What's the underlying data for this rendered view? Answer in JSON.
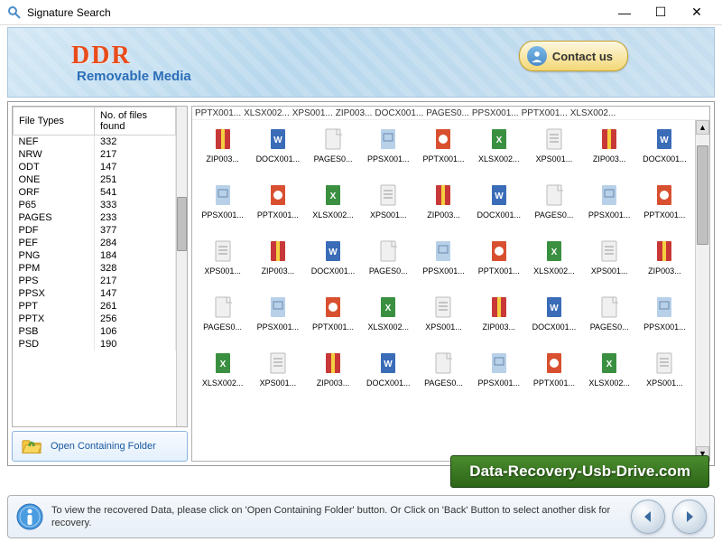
{
  "window": {
    "title": "Signature Search"
  },
  "header": {
    "brand": "DDR",
    "subtitle": "Removable Media",
    "contact_label": "Contact us"
  },
  "table": {
    "col1": "File Types",
    "col2": "No. of files found",
    "rows": [
      {
        "t": "NEF",
        "c": "332"
      },
      {
        "t": "NRW",
        "c": "217"
      },
      {
        "t": "ODT",
        "c": "147"
      },
      {
        "t": "ONE",
        "c": "251"
      },
      {
        "t": "ORF",
        "c": "541"
      },
      {
        "t": "P65",
        "c": "333"
      },
      {
        "t": "PAGES",
        "c": "233"
      },
      {
        "t": "PDF",
        "c": "377"
      },
      {
        "t": "PEF",
        "c": "284"
      },
      {
        "t": "PNG",
        "c": "184"
      },
      {
        "t": "PPM",
        "c": "328"
      },
      {
        "t": "PPS",
        "c": "217"
      },
      {
        "t": "PPSX",
        "c": "147"
      },
      {
        "t": "PPT",
        "c": "261"
      },
      {
        "t": "PPTX",
        "c": "256"
      },
      {
        "t": "PSB",
        "c": "106"
      },
      {
        "t": "PSD",
        "c": "190"
      }
    ]
  },
  "buttons": {
    "open_folder": "Open Containing Folder"
  },
  "breadcrumb": [
    "PPTX001...",
    "XLSX002...",
    "XPS001...",
    "ZIP003...",
    "DOCX001...",
    "PAGES0...",
    "PPSX001...",
    "PPTX001...",
    "XLSX002..."
  ],
  "files": [
    {
      "n": "ZIP003...",
      "k": "zip"
    },
    {
      "n": "DOCX001...",
      "k": "docx"
    },
    {
      "n": "PAGES0...",
      "k": "pages"
    },
    {
      "n": "PPSX001...",
      "k": "ppsx"
    },
    {
      "n": "PPTX001...",
      "k": "pptx"
    },
    {
      "n": "XLSX002...",
      "k": "xlsx"
    },
    {
      "n": "XPS001...",
      "k": "xps"
    },
    {
      "n": "ZIP003...",
      "k": "zip"
    },
    {
      "n": "DOCX001...",
      "k": "docx"
    },
    {
      "n": "PPSX001...",
      "k": "ppsx"
    },
    {
      "n": "PPTX001...",
      "k": "pptx"
    },
    {
      "n": "XLSX002...",
      "k": "xlsx"
    },
    {
      "n": "XPS001...",
      "k": "xps"
    },
    {
      "n": "ZIP003...",
      "k": "zip"
    },
    {
      "n": "DOCX001...",
      "k": "docx"
    },
    {
      "n": "PAGES0...",
      "k": "pages"
    },
    {
      "n": "PPSX001...",
      "k": "ppsx"
    },
    {
      "n": "PPTX001...",
      "k": "pptx"
    },
    {
      "n": "XPS001...",
      "k": "xps"
    },
    {
      "n": "ZIP003...",
      "k": "zip"
    },
    {
      "n": "DOCX001...",
      "k": "docx"
    },
    {
      "n": "PAGES0...",
      "k": "pages"
    },
    {
      "n": "PPSX001...",
      "k": "ppsx"
    },
    {
      "n": "PPTX001...",
      "k": "pptx"
    },
    {
      "n": "XLSX002...",
      "k": "xlsx"
    },
    {
      "n": "XPS001...",
      "k": "xps"
    },
    {
      "n": "ZIP003...",
      "k": "zip"
    },
    {
      "n": "PAGES0...",
      "k": "pages"
    },
    {
      "n": "PPSX001...",
      "k": "ppsx"
    },
    {
      "n": "PPTX001...",
      "k": "pptx"
    },
    {
      "n": "XLSX002...",
      "k": "xlsx"
    },
    {
      "n": "XPS001...",
      "k": "xps"
    },
    {
      "n": "ZIP003...",
      "k": "zip"
    },
    {
      "n": "DOCX001...",
      "k": "docx"
    },
    {
      "n": "PAGES0...",
      "k": "pages"
    },
    {
      "n": "PPSX001...",
      "k": "ppsx"
    },
    {
      "n": "XLSX002...",
      "k": "xlsx"
    },
    {
      "n": "XPS001...",
      "k": "xps"
    },
    {
      "n": "ZIP003...",
      "k": "zip"
    },
    {
      "n": "DOCX001...",
      "k": "docx"
    },
    {
      "n": "PAGES0...",
      "k": "pages"
    },
    {
      "n": "PPSX001...",
      "k": "ppsx"
    },
    {
      "n": "PPTX001...",
      "k": "pptx"
    },
    {
      "n": "XLSX002...",
      "k": "xlsx"
    },
    {
      "n": "XPS001...",
      "k": "xps"
    }
  ],
  "banner": {
    "text": "Data-Recovery-Usb-Drive.com"
  },
  "footer": {
    "text": "To view the recovered Data, please click on 'Open Containing Folder' button. Or Click on 'Back' Button to select another disk for recovery."
  }
}
